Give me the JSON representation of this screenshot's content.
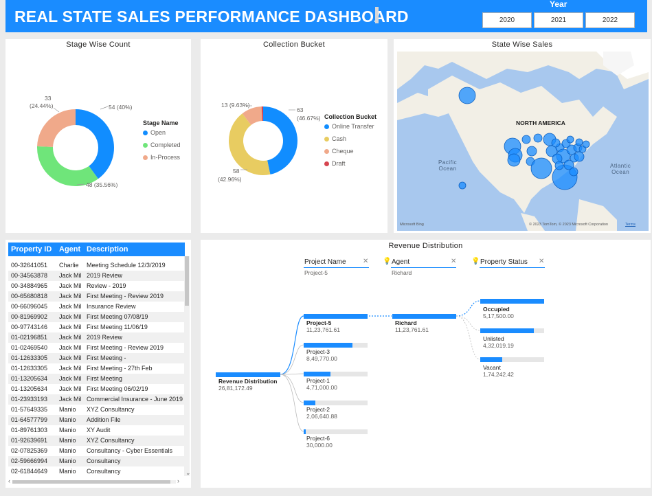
{
  "header": {
    "title": "REAL STATE SALES PERFORMANCE DASHBOARD",
    "year_label": "Year",
    "years": [
      "2020",
      "2021",
      "2022"
    ]
  },
  "stage_chart": {
    "title": "Stage Wise Count",
    "legend_title": "Stage Name",
    "chart_data": {
      "type": "pie",
      "title": "Stage Wise Count",
      "categories": [
        "Open",
        "Completed",
        "In-Process"
      ],
      "values": [
        54,
        48,
        33
      ],
      "labels": [
        "54 (40%)",
        "48 (35.56%)",
        "33\n(24.44%)"
      ],
      "colors": [
        "#118dff",
        "#6fe57a",
        "#f0a98a"
      ]
    },
    "label_open": "54 (40%)",
    "label_completed": "48 (35.56%)",
    "label_inprocess_1": "33",
    "label_inprocess_2": "(24.44%)",
    "legend": [
      "Open",
      "Completed",
      "In-Process"
    ]
  },
  "collection_chart": {
    "title": "Collection Bucket",
    "legend_title": "Collection Bucket",
    "chart_data": {
      "type": "pie",
      "title": "Collection Bucket",
      "categories": [
        "Online Transfer",
        "Cash",
        "Cheque",
        "Draft"
      ],
      "values": [
        63,
        58,
        13,
        1
      ],
      "colors": [
        "#118dff",
        "#e8cc61",
        "#f0a98a",
        "#d64550"
      ]
    },
    "label_online_1": "63",
    "label_online_2": "(46.67%)",
    "label_cash_1": "58",
    "label_cash_2": "(42.96%)",
    "label_cheque": "13 (9.63%)",
    "legend": [
      "Online Transfer",
      "Cash",
      "Cheque",
      "Draft"
    ]
  },
  "map": {
    "title": "State Wise Sales",
    "continent": "NORTH AMERICA",
    "pacific": "Pacific\nOcean",
    "atlantic": "Atlantic\nOcean",
    "bing": "Microsoft Bing",
    "copyright": "© 2023 TomTom, © 2023 Microsoft Corporation",
    "terms": "Terms"
  },
  "table": {
    "headers": [
      "Property ID",
      "Agent",
      "Description"
    ],
    "rows": [
      [
        "00-32641051",
        "Charlie",
        "Meeting Schedule 12/3/2019"
      ],
      [
        "00-34563878",
        "Jack Mil",
        "2019 Review"
      ],
      [
        "00-34884965",
        "Jack Mil",
        "Review - 2019"
      ],
      [
        "00-65680818",
        "Jack Mil",
        "First Meeting - Review 2019"
      ],
      [
        "00-66096045",
        "Jack Mil",
        "Insurance Review"
      ],
      [
        "00-81969902",
        "Jack Mil",
        "First Meeting 07/08/19"
      ],
      [
        "00-97743146",
        "Jack Mil",
        "First Meeting 11/06/19"
      ],
      [
        "01-02196851",
        "Jack Mil",
        "2019 Review"
      ],
      [
        "01-02469540",
        "Jack Mil",
        "First Meeting - Review 2019"
      ],
      [
        "01-12633305",
        "Jack Mil",
        "First Meeting -"
      ],
      [
        "01-12633305",
        "Jack Mil",
        "First Meeting - 27th Feb"
      ],
      [
        "01-13205634",
        "Jack Mil",
        "First Meeting"
      ],
      [
        "01-13205634",
        "Jack Mil",
        "First Meeting 06/02/19"
      ],
      [
        "01-23933193",
        "Jack Mil",
        "Commercial Insurance - June 2019"
      ],
      [
        "01-57649335",
        "Manio",
        "XYZ Consultancy"
      ],
      [
        "01-64577799",
        "Manio",
        "Addition File"
      ],
      [
        "01-89761303",
        "Manio",
        "XY Audit"
      ],
      [
        "01-92639691",
        "Manio",
        "XYZ Consultancy"
      ],
      [
        "02-07825369",
        "Manio",
        "Consultancy - Cyber Essentials"
      ],
      [
        "02-59666994",
        "Manio",
        "Consultancy"
      ],
      [
        "02-61844649",
        "Manio",
        "Consultancy"
      ]
    ]
  },
  "decomp": {
    "title": "Revenue Distribution",
    "filters": [
      {
        "label": "Project Name",
        "value": "Project-5"
      },
      {
        "label": "Agent",
        "value": "Richard"
      },
      {
        "label": "Property Status",
        "value": ""
      }
    ],
    "root": {
      "name": "Revenue Distribution",
      "value": "26,81,172.49"
    },
    "projects": [
      {
        "name": "Project-5",
        "value": "11,23,761.61",
        "share": 1.0
      },
      {
        "name": "Project-3",
        "value": "8,49,770.00",
        "share": 0.76
      },
      {
        "name": "Project-1",
        "value": "4,71,000.00",
        "share": 0.42
      },
      {
        "name": "Project-2",
        "value": "2,06,640.88",
        "share": 0.18
      },
      {
        "name": "Project-6",
        "value": "30,000.00",
        "share": 0.03
      }
    ],
    "agent": {
      "name": "Richard",
      "value": "11,23,761.61"
    },
    "statuses": [
      {
        "name": "Occupied",
        "value": "5,17,500.00",
        "share": 1.0
      },
      {
        "name": "Unlisted",
        "value": "4,32,019.19",
        "share": 0.84
      },
      {
        "name": "Vacant",
        "value": "1,74,242.42",
        "share": 0.34
      }
    ]
  }
}
